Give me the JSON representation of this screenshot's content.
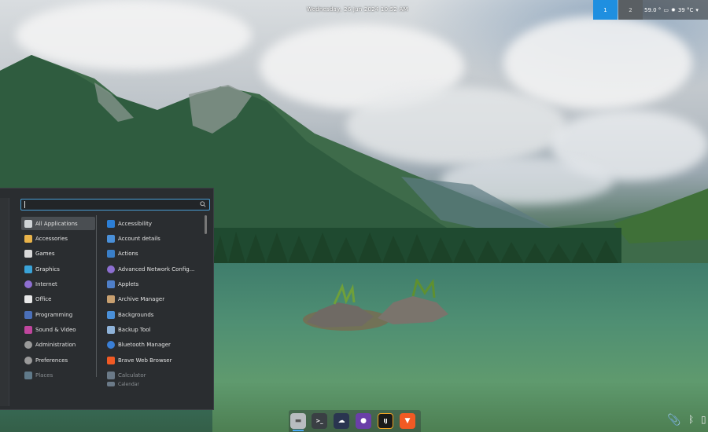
{
  "panel": {
    "datetime": "Wednesday, 26 Jun 2024 10:52 AM",
    "workspaces": [
      "1",
      "2"
    ],
    "active_workspace": "1",
    "tray_temp_weather": "59.0 °",
    "tray_cpu_temp": "39 °C"
  },
  "menu": {
    "search_placeholder": "",
    "categories": [
      {
        "label": "All Applications",
        "icon": "grid-icon",
        "color": "#cfd3d6"
      },
      {
        "label": "Accessories",
        "icon": "accessories-icon",
        "color": "#e8b34a"
      },
      {
        "label": "Games",
        "icon": "games-icon",
        "color": "#d9d9d9"
      },
      {
        "label": "Graphics",
        "icon": "graphics-icon",
        "color": "#3aa3d8"
      },
      {
        "label": "Internet",
        "icon": "internet-icon",
        "color": "#8e6fd1"
      },
      {
        "label": "Office",
        "icon": "office-icon",
        "color": "#e8e8e8"
      },
      {
        "label": "Programming",
        "icon": "programming-icon",
        "color": "#4a6fb8"
      },
      {
        "label": "Sound & Video",
        "icon": "sound-video-icon",
        "color": "#c0469e"
      },
      {
        "label": "Administration",
        "icon": "administration-icon",
        "color": "#9a9a9a"
      },
      {
        "label": "Preferences",
        "icon": "preferences-icon",
        "color": "#9a9a9a"
      },
      {
        "label": "Places",
        "icon": "places-icon",
        "color": "#607a8a"
      }
    ],
    "apps": [
      {
        "label": "Accessibility",
        "icon": "accessibility-icon",
        "color": "#2c7fd6"
      },
      {
        "label": "Account details",
        "icon": "account-icon",
        "color": "#4a90d9"
      },
      {
        "label": "Actions",
        "icon": "actions-icon",
        "color": "#3a7fc8"
      },
      {
        "label": "Advanced Network Config...",
        "icon": "network-icon",
        "color": "#8d6fd1"
      },
      {
        "label": "Applets",
        "icon": "applets-icon",
        "color": "#4f7fc8"
      },
      {
        "label": "Archive Manager",
        "icon": "archive-icon",
        "color": "#c8a070"
      },
      {
        "label": "Backgrounds",
        "icon": "backgrounds-icon",
        "color": "#4a90d9"
      },
      {
        "label": "Backup Tool",
        "icon": "backup-icon",
        "color": "#8fb3d9"
      },
      {
        "label": "Bluetooth Manager",
        "icon": "bluetooth-icon",
        "color": "#3a7fd6"
      },
      {
        "label": "Brave Web Browser",
        "icon": "brave-icon",
        "color": "#f15a24"
      },
      {
        "label": "Calculator",
        "icon": "calculator-icon",
        "color": "#6b7a88"
      },
      {
        "label": "Calendar",
        "icon": "calendar-icon",
        "color": "#6b7a88"
      }
    ]
  },
  "dock": [
    {
      "name": "files",
      "color": "#b8bcc0",
      "glyph": "▬"
    },
    {
      "name": "terminal",
      "color": "#3a3f44",
      "glyph": ">_"
    },
    {
      "name": "chat",
      "color": "#2a3550",
      "glyph": "☁"
    },
    {
      "name": "github",
      "color": "#6a3fa8",
      "glyph": "●"
    },
    {
      "name": "intellij",
      "color": "#1a1a1a",
      "glyph": "IJ"
    },
    {
      "name": "brave",
      "color": "#f15a24",
      "glyph": "▼"
    }
  ]
}
